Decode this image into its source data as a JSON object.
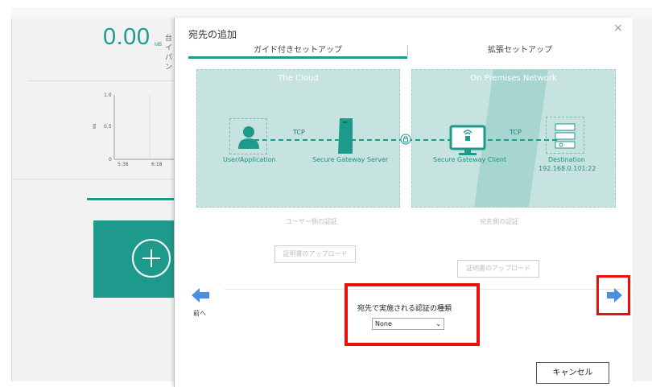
{
  "background": {
    "total_value": "0.00",
    "total_unit": "MB",
    "side_text": "台 イ パ ン",
    "chart": {
      "y_ticks": [
        "1.0",
        "0.5",
        "0"
      ],
      "y_unit": "MB",
      "x_ticks": [
        "5:38",
        "6:18"
      ]
    }
  },
  "dialog": {
    "title": "宛先の追加",
    "close_icon": "×",
    "tabs": [
      {
        "label": "ガイド付きセットアップ",
        "active": true
      },
      {
        "label": "拡張セットアップ",
        "active": false
      }
    ],
    "diagram": {
      "cloud_title": "The Cloud",
      "onprem_title": "On Premises Network",
      "tcp_left": "TCP",
      "tcp_right": "TCP",
      "user_label": "User/Application",
      "server_label": "Secure Gateway Server",
      "client_label": "Secure Gateway Client",
      "destination_label": "Destination",
      "destination_address": "192.168.0.101:22"
    },
    "user_side_auth_label": "ユーザー側の認証",
    "dest_side_auth_label": "宛先側の認証",
    "upload_cert_left": "証明書のアップロード",
    "upload_cert_right": "証明書のアップロード",
    "prev_label": "前へ",
    "auth_type_label": "宛先で実施される認証の種類",
    "auth_type_value": "None",
    "cancel_label": "キャンセル"
  },
  "colors": {
    "accent": "#1e9a8c",
    "highlight": "#e8120c",
    "arrow": "#4a90e2"
  }
}
